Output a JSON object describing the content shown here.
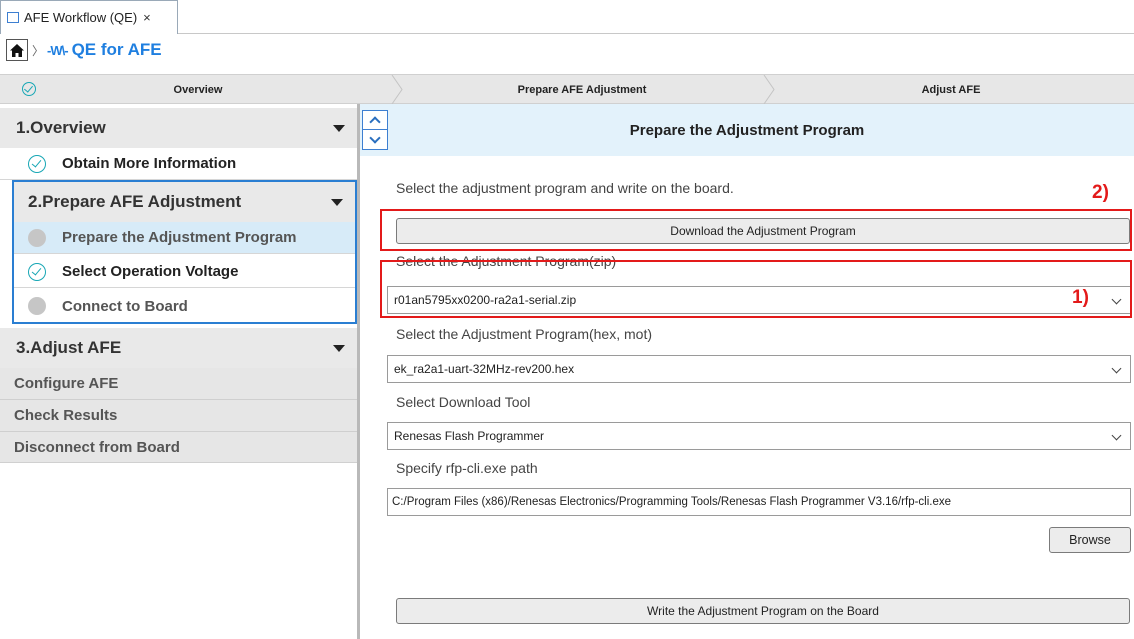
{
  "tab": {
    "title": "AFE Workflow (QE)",
    "close": "×"
  },
  "breadcrumb": {
    "title": "QE for AFE",
    "separator": "〉",
    "wave": "-W\\-"
  },
  "steps": [
    "Overview",
    "Prepare AFE Adjustment",
    "Adjust AFE"
  ],
  "sidebar": {
    "sections": [
      {
        "title": "1.Overview",
        "items": [
          {
            "label": "Obtain More Information",
            "status": "done"
          }
        ]
      },
      {
        "title": "2.Prepare AFE Adjustment",
        "items": [
          {
            "label": "Prepare the Adjustment Program",
            "status": "current"
          },
          {
            "label": "Select Operation Voltage",
            "status": "done"
          },
          {
            "label": "Connect to Board",
            "status": "pending"
          }
        ]
      },
      {
        "title": "3.Adjust AFE",
        "items": [
          {
            "label": "Configure AFE"
          },
          {
            "label": "Check Results"
          },
          {
            "label": "Disconnect from Board"
          }
        ]
      }
    ]
  },
  "main": {
    "title": "Prepare the Adjustment Program",
    "instruction": "Select the adjustment program and write on the board.",
    "download_button": "Download the Adjustment Program",
    "zip_label": "Select the Adjustment Program(zip)",
    "zip_value": "r01an5795xx0200-ra2a1-serial.zip",
    "hex_label": "Select the Adjustment Program(hex, mot)",
    "hex_value": "ek_ra2a1-uart-32MHz-rev200.hex",
    "tool_label": "Select Download Tool",
    "tool_value": "Renesas Flash Programmer",
    "path_label": "Specify rfp-cli.exe path",
    "path_value": "C:/Program Files (x86)/Renesas Electronics/Programming Tools/Renesas Flash Programmer V3.16/rfp-cli.exe",
    "browse_button": "Browse",
    "write_button": "Write the Adjustment Program on the Board"
  },
  "annotations": {
    "label1": "1)",
    "label2": "2)",
    "color": "#e31a1a"
  },
  "colors": {
    "accent": "#1f7fe0",
    "check": "#18a7b5",
    "header_bg": "#e3f2fb"
  }
}
